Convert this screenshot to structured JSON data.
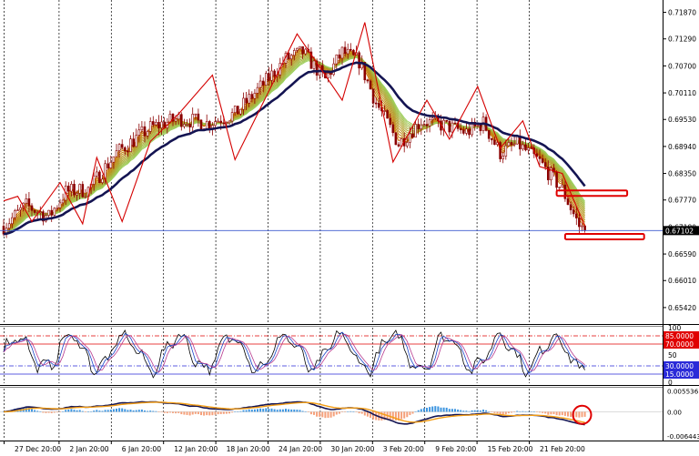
{
  "colors": {
    "background": "#ffffff",
    "grid": "#000000",
    "candle": "#8b0000",
    "zigzag": "#d40000",
    "ribbon_start": "#c87400",
    "ribbon_end": "#9bcf5a",
    "ema_slow": "#141452",
    "price_line": "#3f5ccf",
    "price_label_bg": "#000000",
    "highlight_box": "#e00000",
    "stoch_main": "#000000",
    "stoch_signal_a": "#1a47c9",
    "stoch_signal_b": "#b83a8e",
    "level_red": "#e00000",
    "level_blue": "#2a2ad8",
    "macd_pos": "#3d95e0",
    "macd_neg": "#f5a07a",
    "macd_line": "#141452",
    "macd_signal": "#f39c12",
    "circle": "#e00000"
  },
  "chart_data": [
    {
      "type": "candlestick",
      "panel": "price",
      "y_axis_ticks": [
        "0.71870",
        "0.71290",
        "0.70700",
        "0.70110",
        "0.69530",
        "0.68940",
        "0.68350",
        "0.67770",
        "0.67180",
        "0.66590",
        "0.66010",
        "0.65420"
      ],
      "ylim": [
        0.651,
        0.721
      ],
      "current_price_label": "0.67102",
      "current_price": 0.67102,
      "x_ticks": [
        "27 Dec 20:00",
        "2 Jan 20:00",
        "6 Jan 20:00",
        "12 Jan 20:00",
        "18 Jan 20:00",
        "24 Jan 20:00",
        "30 Jan 20:00",
        "3 Feb 20:00",
        "9 Feb 20:00",
        "15 Feb 20:00",
        "21 Feb 20:00"
      ],
      "trend_anchors": [
        [
          0,
          0.672
        ],
        [
          8,
          0.6765
        ],
        [
          16,
          0.674
        ],
        [
          22,
          0.6795
        ],
        [
          30,
          0.68
        ],
        [
          40,
          0.688
        ],
        [
          52,
          0.6935
        ],
        [
          62,
          0.6955
        ],
        [
          72,
          0.6945
        ],
        [
          82,
          0.6965
        ],
        [
          92,
          0.703
        ],
        [
          100,
          0.7085
        ],
        [
          106,
          0.71
        ],
        [
          114,
          0.704
        ],
        [
          120,
          0.71
        ],
        [
          126,
          0.708
        ],
        [
          132,
          0.699
        ],
        [
          140,
          0.69
        ],
        [
          148,
          0.695
        ],
        [
          156,
          0.694
        ],
        [
          164,
          0.6925
        ],
        [
          170,
          0.6945
        ],
        [
          176,
          0.688
        ],
        [
          182,
          0.69
        ],
        [
          190,
          0.686
        ],
        [
          198,
          0.68
        ],
        [
          204,
          0.672
        ],
        [
          206,
          0.6711
        ]
      ],
      "zigzag": [
        [
          0,
          0.6775
        ],
        [
          5,
          0.6785
        ],
        [
          10,
          0.673
        ],
        [
          20,
          0.6815
        ],
        [
          28,
          0.6725
        ],
        [
          33,
          0.687
        ],
        [
          42,
          0.673
        ],
        [
          52,
          0.6905
        ],
        [
          62,
          0.6965
        ],
        [
          74,
          0.705
        ],
        [
          82,
          0.6865
        ],
        [
          104,
          0.714
        ],
        [
          120,
          0.6995
        ],
        [
          128,
          0.7165
        ],
        [
          138,
          0.686
        ],
        [
          150,
          0.6995
        ],
        [
          158,
          0.691
        ],
        [
          168,
          0.7025
        ],
        [
          176,
          0.689
        ],
        [
          184,
          0.695
        ],
        [
          190,
          0.685
        ],
        [
          198,
          0.6835
        ],
        [
          206,
          0.672
        ]
      ],
      "highlight_boxes": [
        {
          "from_bar": 196,
          "to_bar": 221,
          "price": 0.6792
        },
        {
          "from_bar": 199,
          "to_bar": 227,
          "price": 0.6697
        }
      ]
    },
    {
      "type": "line",
      "panel": "stochastic",
      "ylim": [
        0,
        100
      ],
      "y_axis_ticks": [
        "100",
        "50",
        "0"
      ],
      "levels": [
        {
          "value": 85,
          "label": "85.0000",
          "color": "red"
        },
        {
          "value": 70,
          "label": "70.0000",
          "color": "red"
        },
        {
          "value": 30,
          "label": "30.0000",
          "color": "blue"
        },
        {
          "value": 15,
          "label": "15.0000",
          "color": "blue"
        }
      ]
    },
    {
      "type": "bar",
      "panel": "macd",
      "y_axis_ticks": [
        "0.005536",
        "0.00",
        "-0.006443"
      ],
      "ylim": [
        -0.0072,
        0.0062
      ],
      "annotation": "red circle around latest bars"
    }
  ]
}
